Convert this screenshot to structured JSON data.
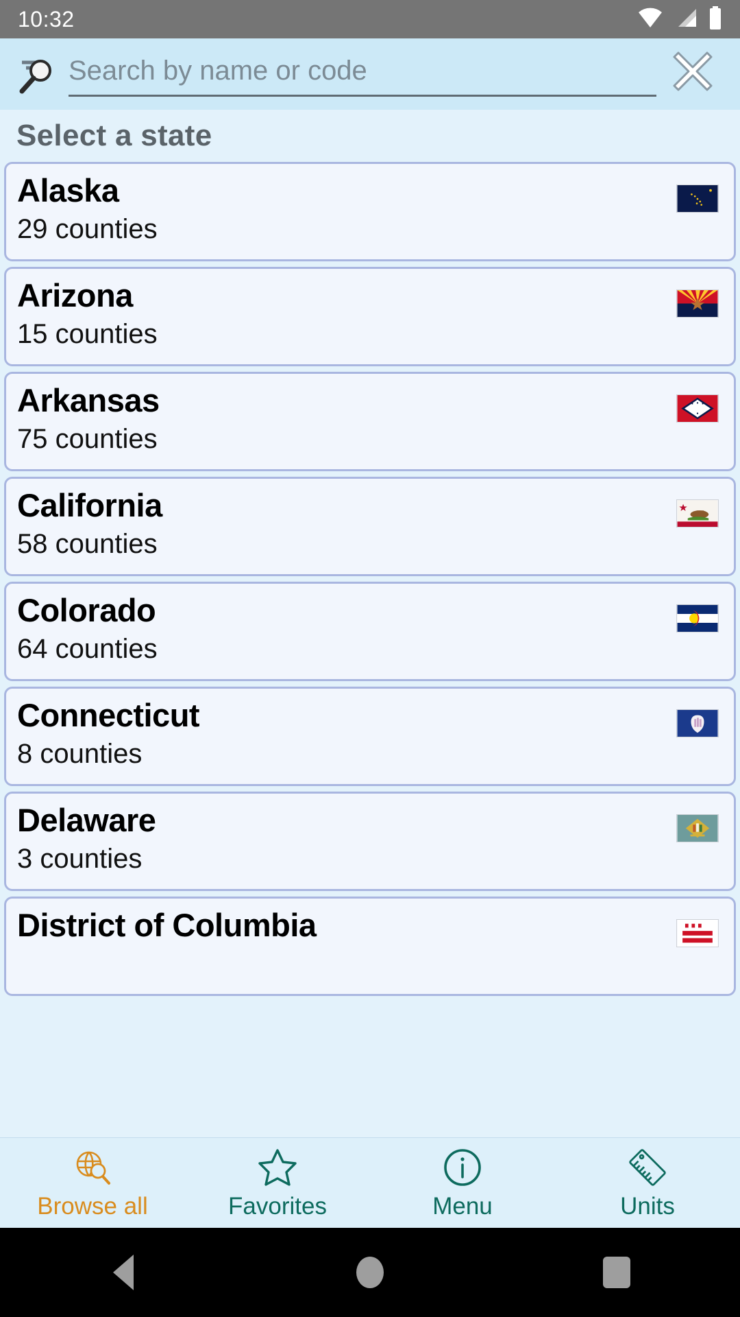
{
  "status_bar": {
    "time": "10:32",
    "icons": [
      "wifi-icon",
      "cellular-signal-icon",
      "battery-icon"
    ]
  },
  "search": {
    "icon": "magnifier-icon",
    "value": "",
    "placeholder": "Search by name or code",
    "clear_icon": "close-x-icon"
  },
  "list_header": {
    "title": "Select a state"
  },
  "states": [
    {
      "name": "Alaska",
      "counties": "29 counties",
      "flag": "alaska-flag"
    },
    {
      "name": "Arizona",
      "counties": "15 counties",
      "flag": "arizona-flag"
    },
    {
      "name": "Arkansas",
      "counties": "75 counties",
      "flag": "arkansas-flag"
    },
    {
      "name": "California",
      "counties": "58 counties",
      "flag": "california-flag"
    },
    {
      "name": "Colorado",
      "counties": "64 counties",
      "flag": "colorado-flag"
    },
    {
      "name": "Connecticut",
      "counties": "8 counties",
      "flag": "connecticut-flag"
    },
    {
      "name": "Delaware",
      "counties": "3 counties",
      "flag": "delaware-flag"
    },
    {
      "name": "District of Columbia",
      "counties": "",
      "flag": "dc-flag"
    }
  ],
  "tabs": [
    {
      "label": "Browse all",
      "icon": "globe-search-icon",
      "active": true
    },
    {
      "label": "Favorites",
      "icon": "star-outline-icon",
      "active": false
    },
    {
      "label": "Menu",
      "icon": "info-circle-icon",
      "active": false
    },
    {
      "label": "Units",
      "icon": "ruler-icon",
      "active": false
    }
  ],
  "nav_bar": {
    "back": "back-triangle-icon",
    "home": "home-circle-icon",
    "recents": "recents-square-icon"
  },
  "colors": {
    "status_bar": "#757575",
    "search_bar": "#CCE9F7",
    "page_background": "#E3F2FB",
    "card_background": "#F2F6FD",
    "card_border": "#A9B6E0",
    "tab_active": "#D98C1E",
    "tab_inactive": "#0D6B5E",
    "tab_bar": "#DDF0FA",
    "header_text": "#5A6369"
  }
}
